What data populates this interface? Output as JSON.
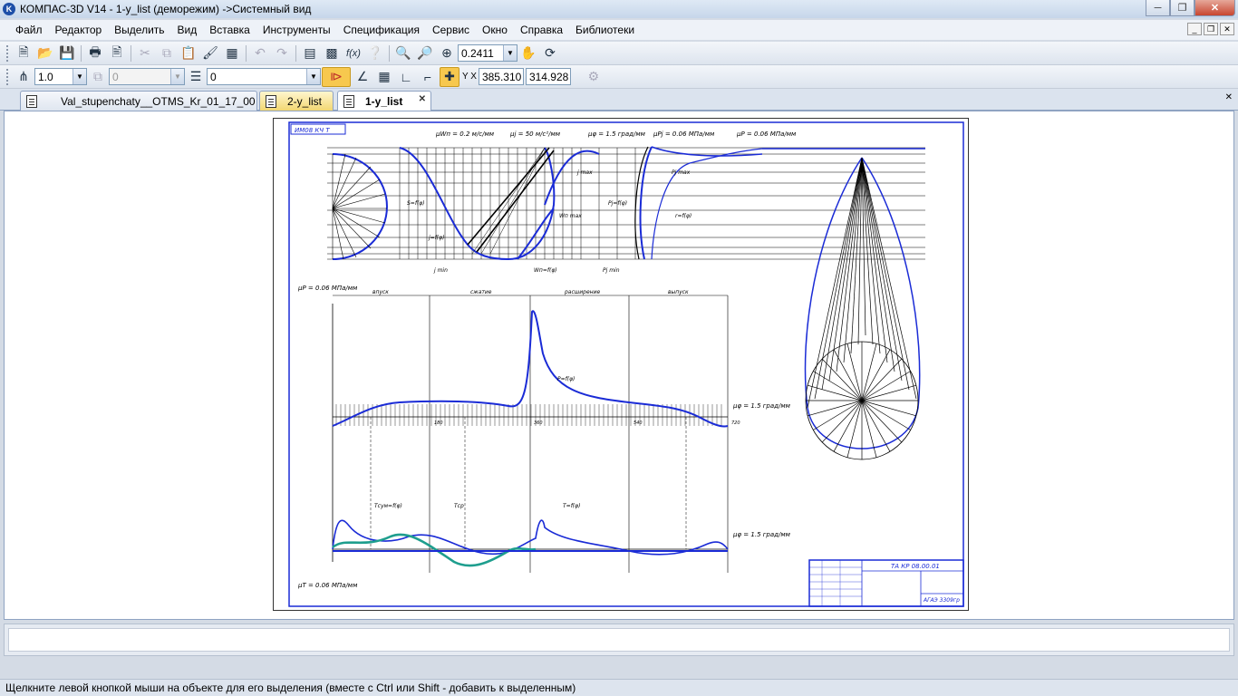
{
  "window": {
    "title": "КОМПАС-3D V14 - 1-y_list (деморежим) ->Системный вид",
    "app_icon": "K",
    "minimize_icon": "minimize-icon",
    "maximize_icon": "maximize-icon",
    "close_icon": "close-icon"
  },
  "menu": {
    "items": [
      "Файл",
      "Редактор",
      "Выделить",
      "Вид",
      "Вставка",
      "Инструменты",
      "Спецификация",
      "Сервис",
      "Окно",
      "Справка",
      "Библиотеки"
    ]
  },
  "toolbar1": {
    "zoom_value": "0.2411"
  },
  "toolbar2": {
    "line_scale": "1.0",
    "layer_disabled": "0",
    "style_value": "0",
    "coord_x": "385.310",
    "coord_y": "314.928"
  },
  "tabs": [
    {
      "label": "Val_stupenchaty__OTMS_Kr_01_17_00"
    },
    {
      "label": "2-y_list"
    },
    {
      "label": "1-y_list"
    }
  ],
  "drawing": {
    "stamp_text": "ТА КР 08.00.01",
    "stamp_top": "ИМ08 КЧ Т",
    "group_code": "АГАЭ 3309гр",
    "diagram_labels": {
      "mu_w": "μWп = 0.2 м/с/мм",
      "mu_j": "μj = 50 м/с²/мм",
      "mu_phi": "μφ = 1.5 град/мм",
      "mu_pj": "μPj = 0.06 МПа/мм",
      "mu_p_right": "μP = 0.06 МПа/мм",
      "mu_p_left": "μP = 0.06 МПа/мм",
      "mu_phi_mid": "μφ = 1.5 град/мм",
      "mu_phi_bottom": "μφ = 1.5 град/мм",
      "mu_t": "μT = 0.06 МПа/мм",
      "j_max": "j max",
      "j_min": "j min",
      "wn_max": "Wп max",
      "wn_f": "Wп=f(φ)",
      "s_f": "S=f(φ)",
      "j_f": "j=f(φ)",
      "pj_f": "Pj=f(φ)",
      "pj_min": "Pj min",
      "pj_max": "Pj max",
      "r_f": "r=f(φ)",
      "p_f": "P=f(φ)",
      "t_f": "T=f(φ)",
      "tsum_f": "Tсум=f(φ)",
      "t_sr": "Tср",
      "phase_intake": "впуск",
      "phase_compression": "сжатие",
      "phase_expansion": "расширение",
      "phase_exhaust": "выпуск",
      "tick_180": "180",
      "tick_360": "360",
      "tick_540": "540",
      "tick_720": "720",
      "s_label": "S = f(φ)"
    }
  },
  "status": {
    "hint": "Щелкните левой кнопкой мыши на объекте для его выделения (вместе с Ctrl или Shift - добавить к выделенным)"
  }
}
